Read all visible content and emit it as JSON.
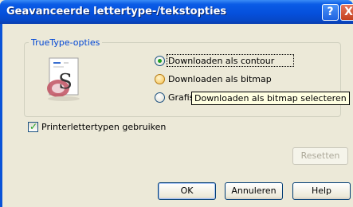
{
  "window": {
    "title": "Geavanceerde lettertype-/tekstopties",
    "help_button": "?",
    "close_button": "X"
  },
  "truetype_group": {
    "legend": "TrueType-opties",
    "options": [
      {
        "label": "Downloaden als contour",
        "selected": true
      },
      {
        "label": "Downloaden als bitmap",
        "selected": false
      },
      {
        "label": "Grafis",
        "selected": false
      }
    ],
    "tooltip": "Downloaden als bitmap selecteren"
  },
  "printer_fonts": {
    "label": "Printerlettertypen gebruiken",
    "checked": true
  },
  "buttons": {
    "reset": "Resetten",
    "ok": "OK",
    "cancel": "Annuleren",
    "help": "Help"
  },
  "colors": {
    "titlebar": "#0550dc",
    "dialog_bg": "#ece9d8",
    "legend_text": "#0046d5",
    "radio_selected": "#21a121",
    "tooltip_bg": "#ffffe1"
  }
}
